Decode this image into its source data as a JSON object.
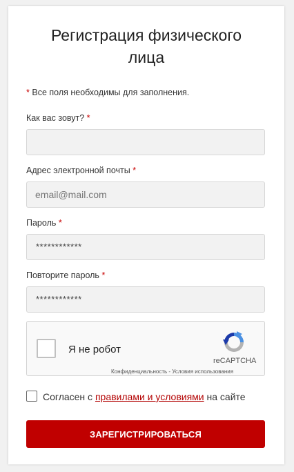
{
  "form": {
    "title": "Регистрация физического лица",
    "required_note": "Все поля необходимы для заполнения.",
    "required_mark": "*",
    "name_label": "Как вас зовут?",
    "name_value": "",
    "email_label": "Адрес электронной почты",
    "email_placeholder": "email@mail.com",
    "password_label": "Пароль",
    "password_value": "************",
    "password_repeat_label": "Повторите пароль",
    "password_repeat_value": "************"
  },
  "recaptcha": {
    "label": "Я не робот",
    "brand": "reCAPTCHA",
    "privacy": "Конфиденциальность",
    "separator": " - ",
    "terms": "Условия использования",
    "colors": {
      "blue": "#4a90e2",
      "gray": "#b3b3b3",
      "dark_blue": "#1c3aa9"
    }
  },
  "agreement": {
    "checked": false,
    "prefix": "Согласен с ",
    "link": "правилами и условиями",
    "suffix": " на сайте"
  },
  "submit": {
    "label": "Зарегистрироваться"
  },
  "colors": {
    "accent": "#c00000",
    "required": "#c80000"
  }
}
